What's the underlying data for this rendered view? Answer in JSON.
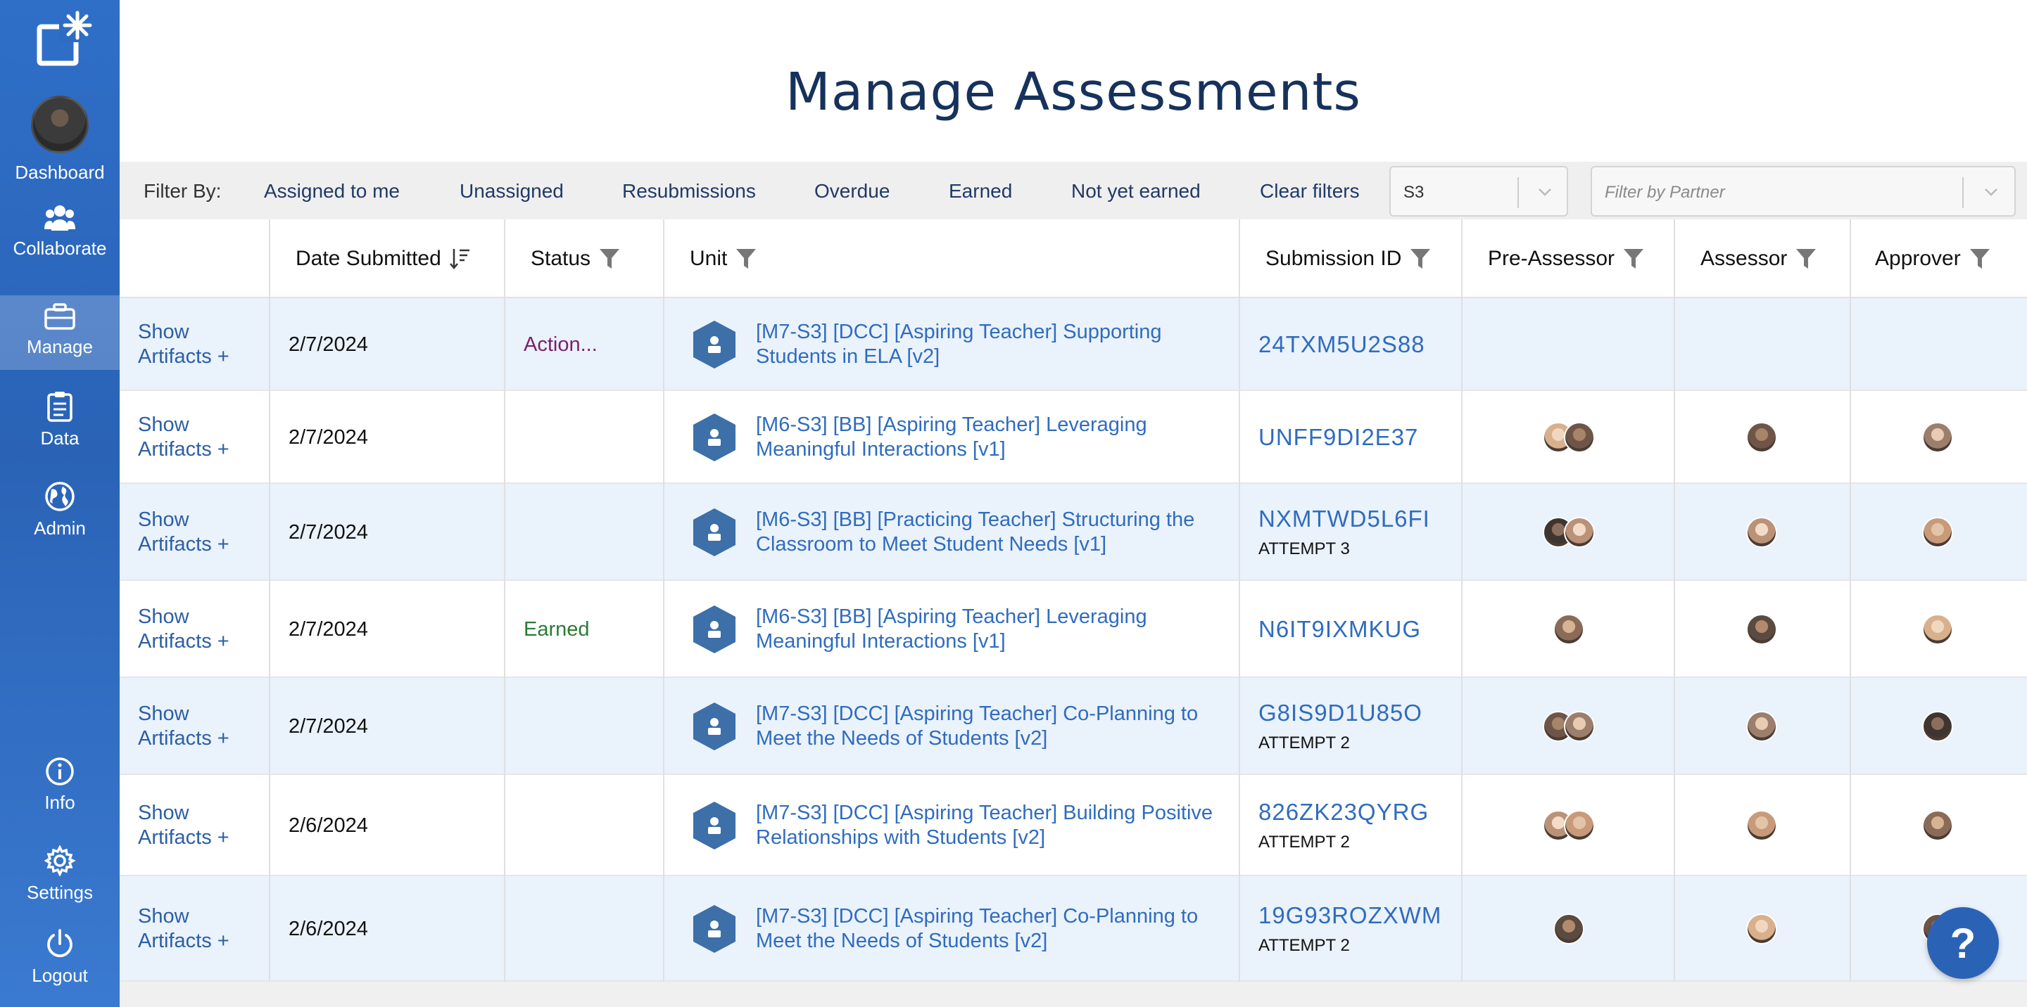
{
  "app": {
    "title": "Manage Assessments"
  },
  "sidebar": {
    "items": [
      {
        "label": "Dashboard",
        "icon": "avatar"
      },
      {
        "label": "Collaborate",
        "icon": "people-icon"
      },
      {
        "label": "Manage",
        "icon": "briefcase-icon",
        "active": true
      },
      {
        "label": "Data",
        "icon": "clipboard-icon"
      },
      {
        "label": "Admin",
        "icon": "globe-icon"
      },
      {
        "label": "Info",
        "icon": "info-icon"
      },
      {
        "label": "Settings",
        "icon": "gear-icon"
      },
      {
        "label": "Logout",
        "icon": "power-icon"
      }
    ]
  },
  "filters": {
    "label": "Filter By:",
    "chips": [
      "Assigned to me",
      "Unassigned",
      "Resubmissions",
      "Overdue",
      "Earned",
      "Not yet earned",
      "Clear filters"
    ],
    "season_value": "S3",
    "partner_placeholder": "Filter by Partner"
  },
  "table": {
    "columns": [
      "",
      "Date Submitted",
      "Status",
      "Unit",
      "Submission ID",
      "Pre-Assessor",
      "Assessor",
      "Approver"
    ],
    "show_label_1": "Show",
    "show_label_2": "Artifacts +",
    "rows": [
      {
        "date": "2/7/2024",
        "status": "Action...",
        "status_type": "action",
        "unit_line1": "[M7-S3] [DCC] [Aspiring Teacher] Supporting",
        "unit_line2": "Students in ELA [v2]",
        "submission_id": "24TXM5U2S88",
        "attempt": "",
        "pre": 0,
        "assessor": 0,
        "approver": 0
      },
      {
        "date": "2/7/2024",
        "status": "",
        "status_type": "",
        "unit_line1": "[M6-S3] [BB] [Aspiring Teacher] Leveraging",
        "unit_line2": "Meaningful Interactions [v1]",
        "submission_id": "UNFF9DI2E37",
        "attempt": "",
        "pre": 2,
        "assessor": 1,
        "approver": 1
      },
      {
        "date": "2/7/2024",
        "status": "",
        "status_type": "",
        "unit_line1": "[M6-S3] [BB] [Practicing Teacher] Structuring the",
        "unit_line2": "Classroom to Meet Student Needs [v1]",
        "submission_id": "NXMTWD5L6FI",
        "attempt": "ATTEMPT 3",
        "pre": 2,
        "assessor": 1,
        "approver": 1
      },
      {
        "date": "2/7/2024",
        "status": "Earned",
        "status_type": "earned",
        "unit_line1": "[M6-S3] [BB] [Aspiring Teacher] Leveraging",
        "unit_line2": "Meaningful Interactions [v1]",
        "submission_id": "N6IT9IXMKUG",
        "attempt": "",
        "pre": 1,
        "assessor": 1,
        "approver": 1
      },
      {
        "date": "2/7/2024",
        "status": "",
        "status_type": "",
        "unit_line1": "[M7-S3] [DCC] [Aspiring Teacher] Co-Planning to",
        "unit_line2": "Meet the Needs of Students [v2]",
        "submission_id": "G8IS9D1U85O",
        "attempt": "ATTEMPT 2",
        "pre": 2,
        "assessor": 1,
        "approver": 1
      },
      {
        "date": "2/6/2024",
        "status": "",
        "status_type": "",
        "unit_line1": "[M7-S3] [DCC] [Aspiring Teacher] Building Positive",
        "unit_line2": "Relationships with Students [v2]",
        "submission_id": "826ZK23QYRG",
        "attempt": "ATTEMPT 2",
        "pre": 2,
        "assessor": 1,
        "approver": 1
      },
      {
        "date": "2/6/2024",
        "status": "",
        "status_type": "",
        "unit_line1": "[M7-S3] [DCC] [Aspiring Teacher] Co-Planning to",
        "unit_line2": "Meet the Needs of Students [v2]",
        "submission_id": "19G93ROZXWM",
        "attempt": "ATTEMPT 2",
        "pre": 1,
        "assessor": 1,
        "approver": 1
      }
    ]
  },
  "help": {
    "label": "?"
  },
  "colors": {
    "sidebar": "#2a63b6",
    "title": "#16325c",
    "link": "#2f6cbf",
    "row_alt": "#eaf2fb",
    "status_action": "#7a1f6d",
    "status_earned": "#2c7a35"
  }
}
